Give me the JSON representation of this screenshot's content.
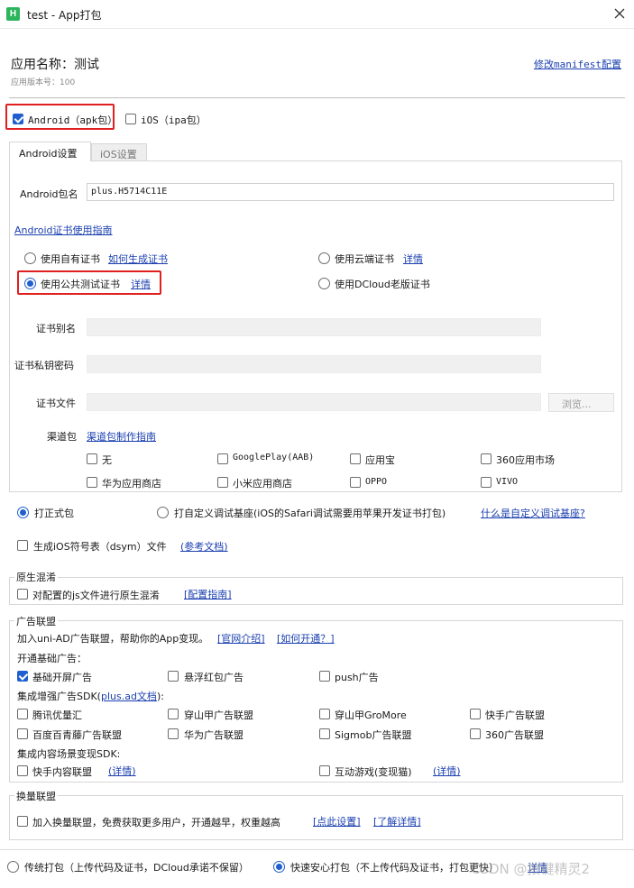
{
  "window": {
    "title": "test - App打包",
    "app_icon_letter": "H"
  },
  "header": {
    "app_name": "应用名称：测试",
    "version": "应用版本号：100",
    "manifest_link": "修改manifest配置"
  },
  "platforms": {
    "android": "Android（apk包）",
    "ios": "iOS（ipa包）"
  },
  "tabs": {
    "android": "Android设置",
    "ios": "iOS设置"
  },
  "android": {
    "package_label": "Android包名",
    "package_value": "plus.H5714C11E",
    "cert_guide": "Android证书使用指南",
    "cert_own": "使用自有证书",
    "cert_own_link": "如何生成证书",
    "cert_cloud": "使用云端证书",
    "cert_cloud_link": "详情",
    "cert_public": "使用公共测试证书",
    "cert_public_link": "详情",
    "cert_dcloud": "使用DCloud老版证书",
    "alias_label": "证书别名",
    "password_label": "证书私钥密码",
    "file_label": "证书文件",
    "browse": "浏览...",
    "channel_label": "渠道包",
    "channel_guide": "渠道包制作指南",
    "channels": {
      "none": "无",
      "googleplay": "GooglePlay(AAB)",
      "yyb": "应用宝",
      "s360": "360应用市场",
      "huawei": "华为应用商店",
      "xiaomi": "小米应用商店",
      "oppo": "OPPO",
      "vivo": "VIVO"
    }
  },
  "build": {
    "formal": "打正式包",
    "custom_base": "打自定义调试基座(iOS的Safari调试需要用苹果开发证书打包)",
    "custom_base_link": "什么是自定义调试基座?",
    "dsym": "生成iOS符号表（dsym）文件",
    "dsym_link": "(参考文档)"
  },
  "obfuscation": {
    "title": "原生混淆",
    "label": "对配置的js文件进行原生混淆",
    "link": "[配置指南]"
  },
  "ads": {
    "title": "广告联盟",
    "intro": "加入uni-AD广告联盟，帮助你的App变现。",
    "intro_link1": "[官网介绍]",
    "intro_link2": "[如何开通？]",
    "basic_title": "开通基础广告：",
    "splash": "基础开屏广告",
    "redpacket": "悬浮红包广告",
    "push": "push广告",
    "sdk_title_pre": "集成增强广告SDK(",
    "sdk_title_link": "plus.ad文档",
    "sdk_title_post": "):",
    "tencent": "腾讯优量汇",
    "csj": "穿山甲广告联盟",
    "csj_gromore": "穿山甲GroMore",
    "kuaishou": "快手广告联盟",
    "baidu": "百度百青藤广告联盟",
    "huawei": "华为广告联盟",
    "sigmob": "Sigmob广告联盟",
    "ad360": "360广告联盟",
    "content_title": "集成内容场景变现SDK:",
    "kuaishou_content": "快手内容联盟",
    "kuaishou_content_link": "(详情)",
    "game": "互动游戏(变现猫)",
    "game_link": "(详情)"
  },
  "exchange": {
    "title": "换量联盟",
    "label": "加入换量联盟，免费获取更多用户，开通越早，权重越高",
    "link1": "[点此设置]",
    "link2": "[了解详情]"
  },
  "footer": {
    "traditional": "传统打包（上传代码及证书，DCloud承诺不保留）",
    "fast": "快速安心打包（不上传代码及证书，打包更快）",
    "link": "详情",
    "watermark": "CSDN @按键精灵2"
  },
  "colors": {
    "accent": "#1f5fcf",
    "link": "#1a3fb0",
    "highlight": "#e02020",
    "brand_green": "#2db55d"
  }
}
